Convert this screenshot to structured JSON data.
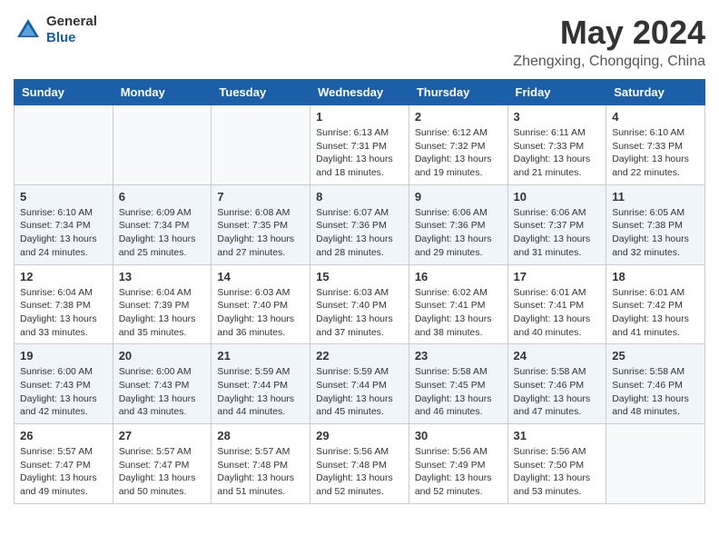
{
  "header": {
    "logo": {
      "general": "General",
      "blue": "Blue"
    },
    "title": "May 2024",
    "location": "Zhengxing, Chongqing, China"
  },
  "weekdays": [
    "Sunday",
    "Monday",
    "Tuesday",
    "Wednesday",
    "Thursday",
    "Friday",
    "Saturday"
  ],
  "weeks": [
    [
      {
        "day": "",
        "info": ""
      },
      {
        "day": "",
        "info": ""
      },
      {
        "day": "",
        "info": ""
      },
      {
        "day": "1",
        "info": "Sunrise: 6:13 AM\nSunset: 7:31 PM\nDaylight: 13 hours and 18 minutes."
      },
      {
        "day": "2",
        "info": "Sunrise: 6:12 AM\nSunset: 7:32 PM\nDaylight: 13 hours and 19 minutes."
      },
      {
        "day": "3",
        "info": "Sunrise: 6:11 AM\nSunset: 7:33 PM\nDaylight: 13 hours and 21 minutes."
      },
      {
        "day": "4",
        "info": "Sunrise: 6:10 AM\nSunset: 7:33 PM\nDaylight: 13 hours and 22 minutes."
      }
    ],
    [
      {
        "day": "5",
        "info": "Sunrise: 6:10 AM\nSunset: 7:34 PM\nDaylight: 13 hours and 24 minutes."
      },
      {
        "day": "6",
        "info": "Sunrise: 6:09 AM\nSunset: 7:34 PM\nDaylight: 13 hours and 25 minutes."
      },
      {
        "day": "7",
        "info": "Sunrise: 6:08 AM\nSunset: 7:35 PM\nDaylight: 13 hours and 27 minutes."
      },
      {
        "day": "8",
        "info": "Sunrise: 6:07 AM\nSunset: 7:36 PM\nDaylight: 13 hours and 28 minutes."
      },
      {
        "day": "9",
        "info": "Sunrise: 6:06 AM\nSunset: 7:36 PM\nDaylight: 13 hours and 29 minutes."
      },
      {
        "day": "10",
        "info": "Sunrise: 6:06 AM\nSunset: 7:37 PM\nDaylight: 13 hours and 31 minutes."
      },
      {
        "day": "11",
        "info": "Sunrise: 6:05 AM\nSunset: 7:38 PM\nDaylight: 13 hours and 32 minutes."
      }
    ],
    [
      {
        "day": "12",
        "info": "Sunrise: 6:04 AM\nSunset: 7:38 PM\nDaylight: 13 hours and 33 minutes."
      },
      {
        "day": "13",
        "info": "Sunrise: 6:04 AM\nSunset: 7:39 PM\nDaylight: 13 hours and 35 minutes."
      },
      {
        "day": "14",
        "info": "Sunrise: 6:03 AM\nSunset: 7:40 PM\nDaylight: 13 hours and 36 minutes."
      },
      {
        "day": "15",
        "info": "Sunrise: 6:03 AM\nSunset: 7:40 PM\nDaylight: 13 hours and 37 minutes."
      },
      {
        "day": "16",
        "info": "Sunrise: 6:02 AM\nSunset: 7:41 PM\nDaylight: 13 hours and 38 minutes."
      },
      {
        "day": "17",
        "info": "Sunrise: 6:01 AM\nSunset: 7:41 PM\nDaylight: 13 hours and 40 minutes."
      },
      {
        "day": "18",
        "info": "Sunrise: 6:01 AM\nSunset: 7:42 PM\nDaylight: 13 hours and 41 minutes."
      }
    ],
    [
      {
        "day": "19",
        "info": "Sunrise: 6:00 AM\nSunset: 7:43 PM\nDaylight: 13 hours and 42 minutes."
      },
      {
        "day": "20",
        "info": "Sunrise: 6:00 AM\nSunset: 7:43 PM\nDaylight: 13 hours and 43 minutes."
      },
      {
        "day": "21",
        "info": "Sunrise: 5:59 AM\nSunset: 7:44 PM\nDaylight: 13 hours and 44 minutes."
      },
      {
        "day": "22",
        "info": "Sunrise: 5:59 AM\nSunset: 7:44 PM\nDaylight: 13 hours and 45 minutes."
      },
      {
        "day": "23",
        "info": "Sunrise: 5:58 AM\nSunset: 7:45 PM\nDaylight: 13 hours and 46 minutes."
      },
      {
        "day": "24",
        "info": "Sunrise: 5:58 AM\nSunset: 7:46 PM\nDaylight: 13 hours and 47 minutes."
      },
      {
        "day": "25",
        "info": "Sunrise: 5:58 AM\nSunset: 7:46 PM\nDaylight: 13 hours and 48 minutes."
      }
    ],
    [
      {
        "day": "26",
        "info": "Sunrise: 5:57 AM\nSunset: 7:47 PM\nDaylight: 13 hours and 49 minutes."
      },
      {
        "day": "27",
        "info": "Sunrise: 5:57 AM\nSunset: 7:47 PM\nDaylight: 13 hours and 50 minutes."
      },
      {
        "day": "28",
        "info": "Sunrise: 5:57 AM\nSunset: 7:48 PM\nDaylight: 13 hours and 51 minutes."
      },
      {
        "day": "29",
        "info": "Sunrise: 5:56 AM\nSunset: 7:48 PM\nDaylight: 13 hours and 52 minutes."
      },
      {
        "day": "30",
        "info": "Sunrise: 5:56 AM\nSunset: 7:49 PM\nDaylight: 13 hours and 52 minutes."
      },
      {
        "day": "31",
        "info": "Sunrise: 5:56 AM\nSunset: 7:50 PM\nDaylight: 13 hours and 53 minutes."
      },
      {
        "day": "",
        "info": ""
      }
    ]
  ]
}
